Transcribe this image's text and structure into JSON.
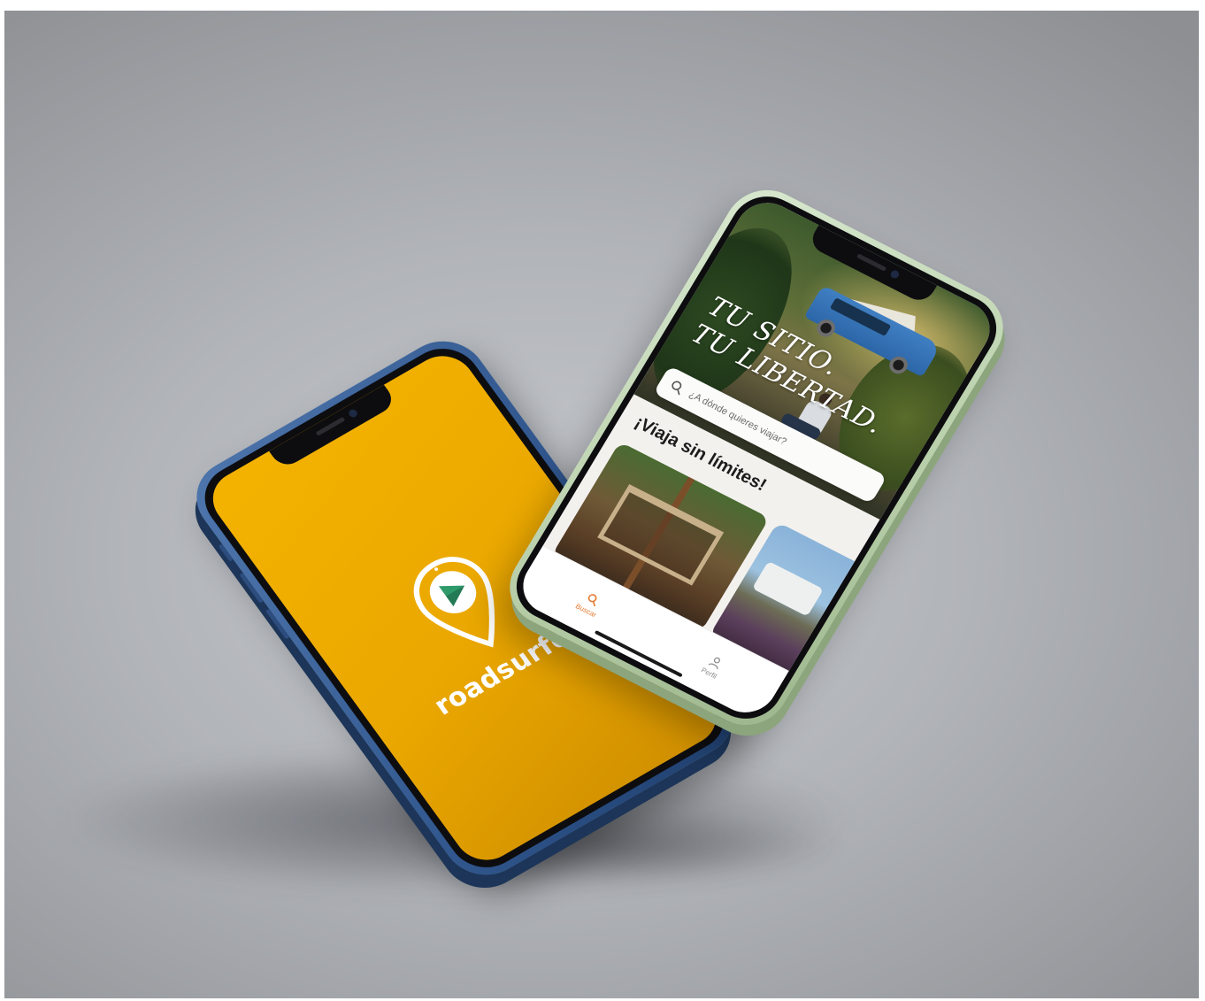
{
  "splash": {
    "brand_name": "roadsurfer",
    "background_color": "#f2b200",
    "frame_color": "#2f558c",
    "logo_icon": "map-pin-play-icon"
  },
  "home": {
    "tagline_line1": "Tu sitio.",
    "tagline_line2": "Tu libertad.",
    "search": {
      "placeholder": "¿A dónde quieres viajar?",
      "icon": "search-icon"
    },
    "section_title": "¡Viaja sin límites!",
    "tabs": [
      {
        "label": "Buscar",
        "icon": "search-icon",
        "active": true
      },
      {
        "label": "Perfil",
        "icon": "user-icon",
        "active": false
      }
    ],
    "accent_color": "#e7782f",
    "frame_color": "#b8cfaa"
  }
}
